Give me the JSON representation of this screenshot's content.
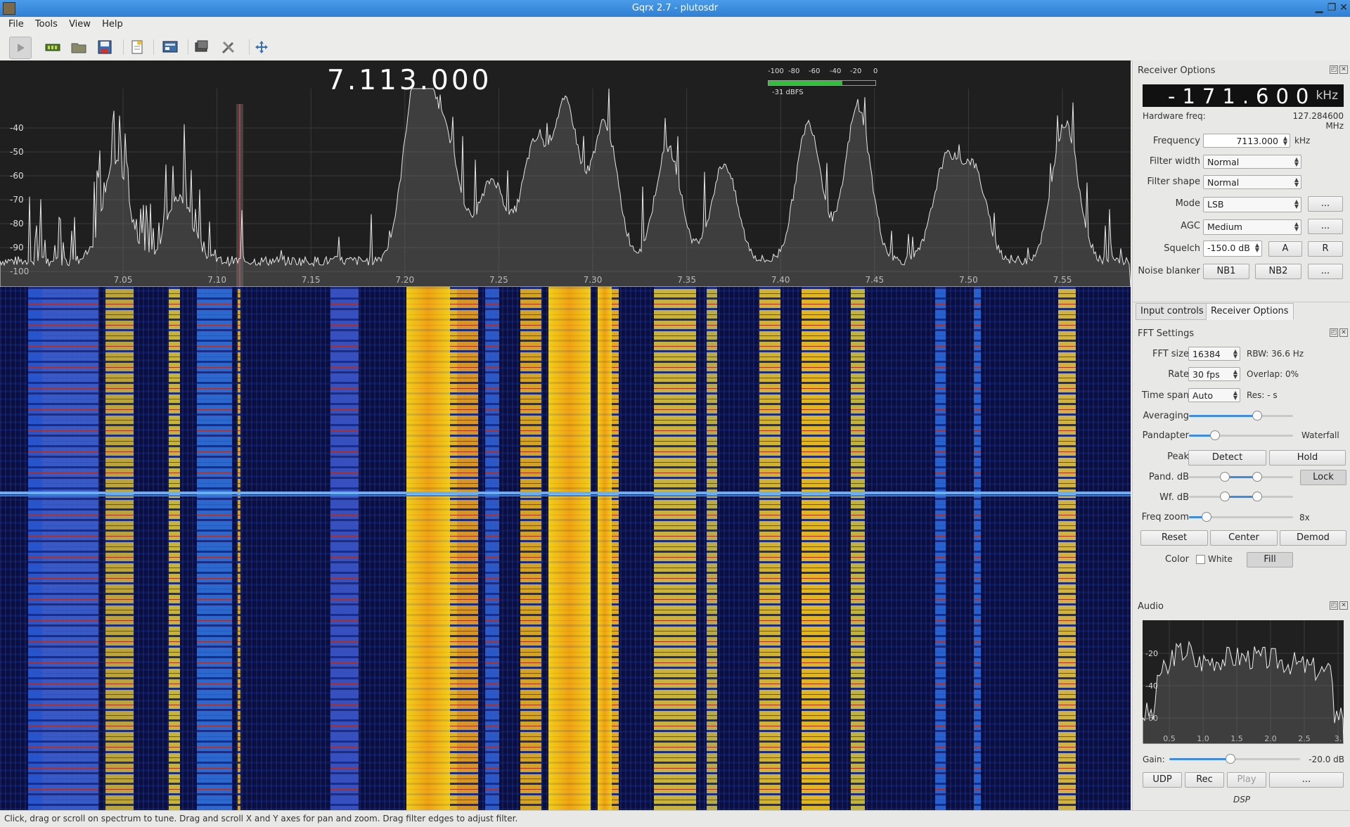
{
  "window": {
    "title": "Gqrx 2.7 - plutosdr"
  },
  "menu": [
    "File",
    "Tools",
    "View",
    "Help"
  ],
  "toolbar": [
    "play-icon",
    "hardware-icon",
    "open-icon",
    "save-icon",
    "bookmark-icon",
    "remote-control-icon",
    "screenshot-icon",
    "settings-icon",
    "fullscreen-icon"
  ],
  "main_display": {
    "frequency": "7.113.000",
    "meter": {
      "scale": [
        "-100",
        "-80",
        "-60",
        "-40",
        "-20",
        "0"
      ],
      "readout": "-31 dBFS",
      "level_dbfs": -31
    },
    "db_ticks": [
      "-40",
      "-50",
      "-60",
      "-70",
      "-80",
      "-90",
      "-100"
    ],
    "freq_ticks": [
      "7.05",
      "7.10",
      "7.15",
      "7.20",
      "7.25",
      "7.30",
      "7.35",
      "7.40",
      "7.45",
      "7.50",
      "7.55"
    ]
  },
  "status": "Click, drag or scroll on spectrum to tune. Drag and scroll X and Y axes for pan and zoom. Drag filter edges to adjust filter.",
  "receiver": {
    "title": "Receiver Options",
    "offset": "-171.600",
    "offset_unit": "kHz",
    "hw_label": "Hardware freq:",
    "hw_value": "127.284600 MHz",
    "freq_label": "Frequency",
    "freq_value": "7113.000",
    "freq_unit": "kHz",
    "filter_width_label": "Filter width",
    "filter_width": "Normal",
    "filter_shape_label": "Filter shape",
    "filter_shape": "Normal",
    "mode_label": "Mode",
    "mode": "LSB",
    "agc_label": "AGC",
    "agc": "Medium",
    "squelch_label": "Squelch",
    "squelch": "-150.0 dB",
    "squelch_a": "A",
    "squelch_r": "R",
    "nb_label": "Noise blanker",
    "nb1": "NB1",
    "nb2": "NB2",
    "more": "..."
  },
  "tabs": [
    "Input controls",
    "Receiver Options"
  ],
  "fft": {
    "title": "FFT Settings",
    "size_label": "FFT size",
    "size": "16384",
    "rbw": "RBW: 36.6 Hz",
    "rate_label": "Rate",
    "rate": "30 fps",
    "overlap": "Overlap: 0%",
    "span_label": "Time span",
    "span": "Auto",
    "res": "Res: - s",
    "avg_label": "Averaging",
    "pandapter_label": "Pandapter",
    "waterfall_label": "Waterfall",
    "peak_label": "Peak",
    "detect": "Detect",
    "hold": "Hold",
    "pand_db_label": "Pand. dB",
    "lock": "Lock",
    "wf_db_label": "Wf. dB",
    "zoom_label": "Freq zoom",
    "zoom_value": "8x",
    "reset": "Reset",
    "center": "Center",
    "demod": "Demod",
    "color_label": "Color",
    "white": "White",
    "fill": "Fill"
  },
  "audio": {
    "title": "Audio",
    "y_ticks": [
      "-20",
      "-40",
      "-60"
    ],
    "x_ticks": [
      "0.5",
      "1.0",
      "1.5",
      "2.0",
      "2.5",
      "3."
    ],
    "gain_label": "Gain:",
    "gain_value": "-20.0 dB",
    "udp": "UDP",
    "rec": "Rec",
    "play": "Play",
    "more": "...",
    "dsp": "DSP"
  }
}
